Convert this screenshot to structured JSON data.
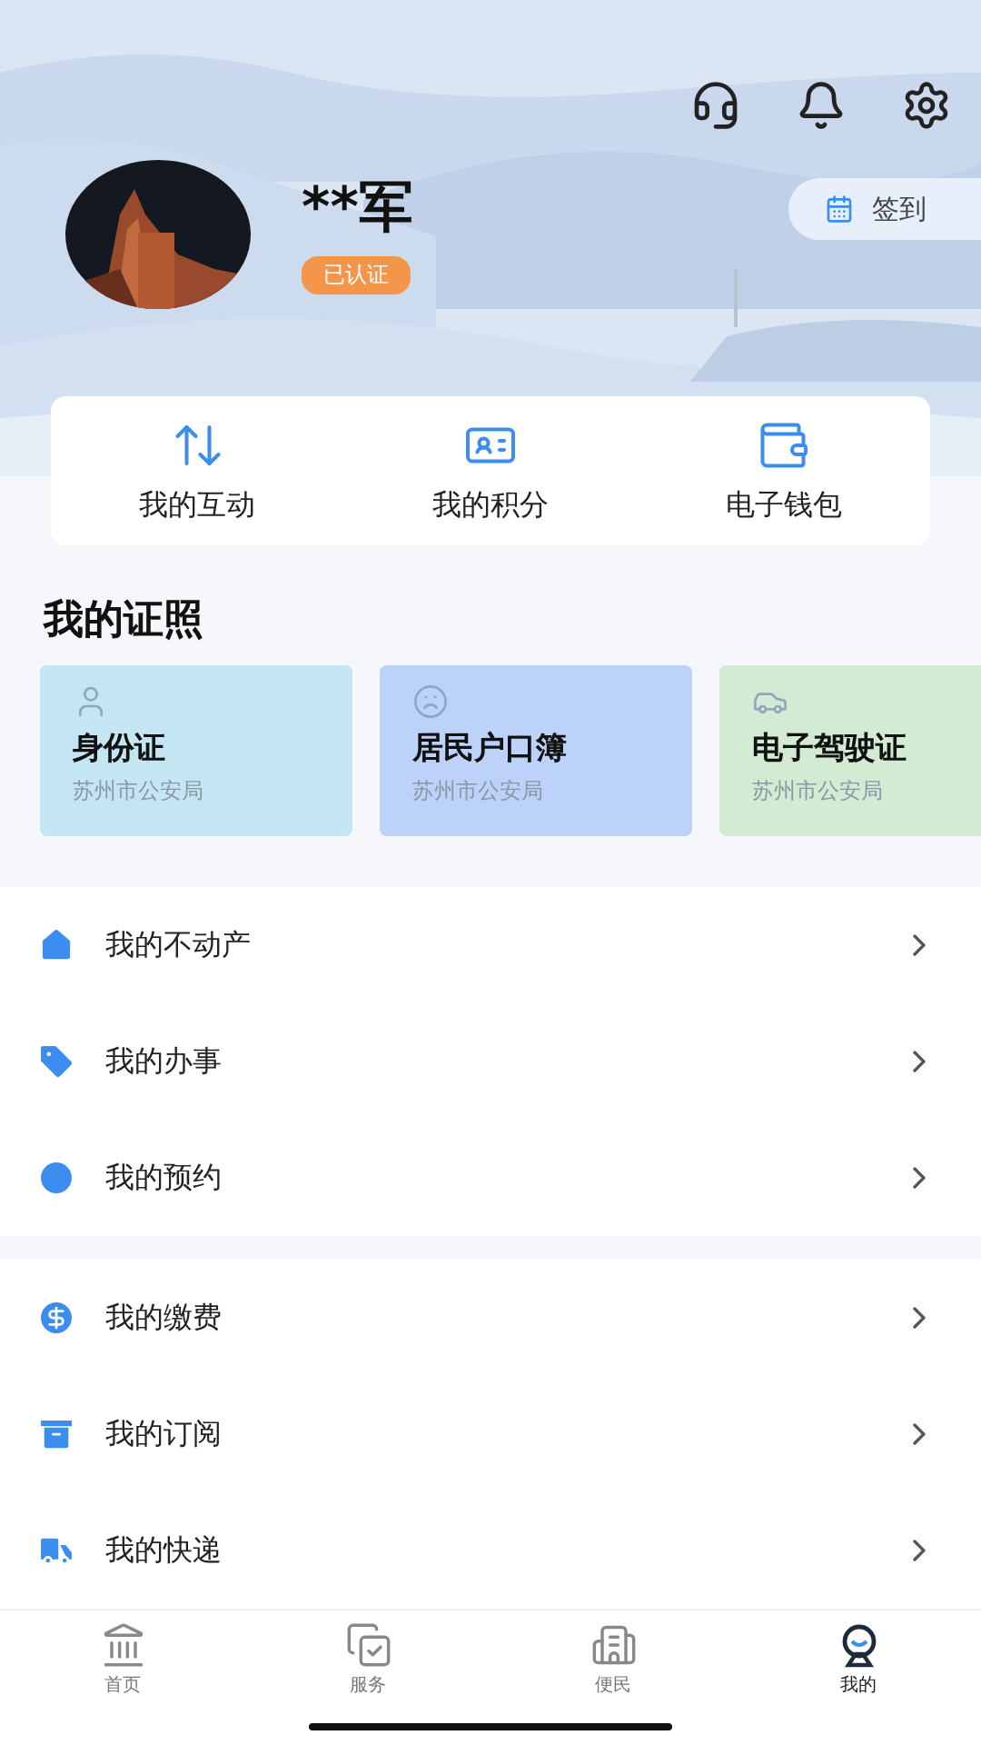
{
  "profile": {
    "name": "**军",
    "badge": "已认证",
    "checkin": "签到"
  },
  "quick_actions": [
    {
      "label": "我的互动"
    },
    {
      "label": "我的积分"
    },
    {
      "label": "电子钱包"
    }
  ],
  "licenses": {
    "title": "我的证照",
    "items": [
      {
        "name": "身份证",
        "issuer": "苏州市公安局",
        "color": "#c4e6f3"
      },
      {
        "name": "居民户口簿",
        "issuer": "苏州市公安局",
        "color": "#bcd2f8"
      },
      {
        "name": "电子驾驶证",
        "issuer": "苏州市公安局",
        "color": "#d3ebd3"
      }
    ]
  },
  "menu_groups": [
    [
      {
        "label": "我的不动产"
      },
      {
        "label": "我的办事"
      },
      {
        "label": "我的预约"
      }
    ],
    [
      {
        "label": "我的缴费"
      },
      {
        "label": "我的订阅"
      },
      {
        "label": "我的快递"
      }
    ]
  ],
  "tabs": [
    {
      "label": "首页",
      "selected": false
    },
    {
      "label": "服务",
      "selected": false
    },
    {
      "label": "便民",
      "selected": false
    },
    {
      "label": "我的",
      "selected": true
    }
  ]
}
